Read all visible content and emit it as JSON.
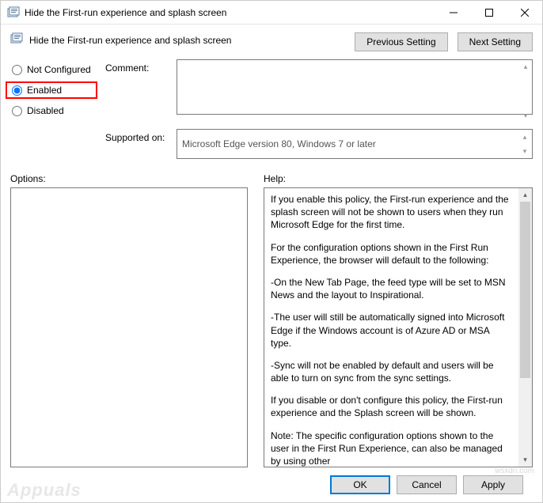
{
  "window": {
    "title": "Hide the First-run experience and splash screen",
    "policy_title": "Hide the First-run experience and splash screen"
  },
  "nav": {
    "previous": "Previous Setting",
    "next": "Next Setting"
  },
  "state": {
    "not_configured_label": "Not Configured",
    "enabled_label": "Enabled",
    "disabled_label": "Disabled",
    "selected": "enabled"
  },
  "fields": {
    "comment_label": "Comment:",
    "comment_value": "",
    "supported_label": "Supported on:",
    "supported_value": "Microsoft Edge version 80, Windows 7 or later"
  },
  "panels": {
    "options_label": "Options:",
    "help_label": "Help:"
  },
  "help": {
    "p1": "If you enable this policy, the First-run experience and the splash screen will not be shown to users when they run Microsoft Edge for the first time.",
    "p2": "For the configuration options shown in the First Run Experience, the browser will default to the following:",
    "p3": "-On the New Tab Page, the feed type will be set to MSN News and the layout to Inspirational.",
    "p4": "-The user will still be automatically signed into Microsoft Edge if the Windows account is of Azure AD or MSA type.",
    "p5": "-Sync will not be enabled by default and users will be able to turn on sync from the sync settings.",
    "p6": "If you disable or don't configure this policy, the First-run experience and the Splash screen will be shown.",
    "p7": "Note: The specific configuration options shown to the user in the First Run Experience, can also be managed by using other"
  },
  "buttons": {
    "ok": "OK",
    "cancel": "Cancel",
    "apply": "Apply"
  },
  "watermark": {
    "main": "Appuals",
    "small": "wsxdn.com"
  }
}
